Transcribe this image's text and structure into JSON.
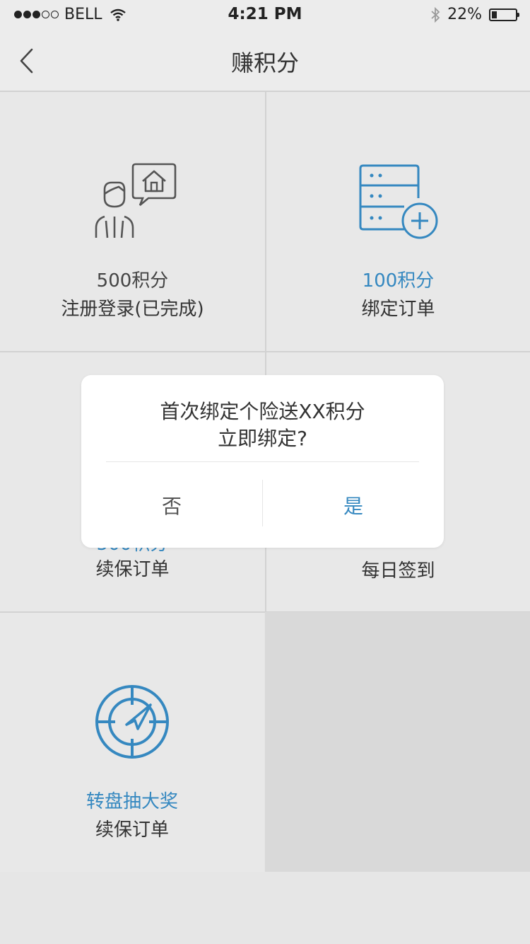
{
  "status_bar": {
    "carrier": "BELL",
    "time": "4:21 PM",
    "battery_percent": "22%",
    "battery_level": 0.22
  },
  "nav": {
    "title": "赚积分",
    "back_icon": "chevron-left-icon"
  },
  "cards": [
    {
      "points": "500积分",
      "label": "注册登录(已完成)",
      "icon": "user-chat-home-icon"
    },
    {
      "points": "100积分",
      "label": "绑定订单",
      "icon": "server-add-icon"
    },
    {
      "points": "500积分",
      "label": "续保订单",
      "icon": "renew-icon"
    },
    {
      "points": "",
      "label": "每日签到",
      "icon": "calendar-icon"
    },
    {
      "points": "转盘抽大奖",
      "label": "续保订单",
      "icon": "radar-icon"
    }
  ],
  "dialog": {
    "line1": "首次绑定个险送XX积分",
    "line2": "立即绑定?",
    "no_label": "否",
    "yes_label": "是"
  },
  "colors": {
    "accent": "#3588c0",
    "icon_gray": "#555555"
  }
}
